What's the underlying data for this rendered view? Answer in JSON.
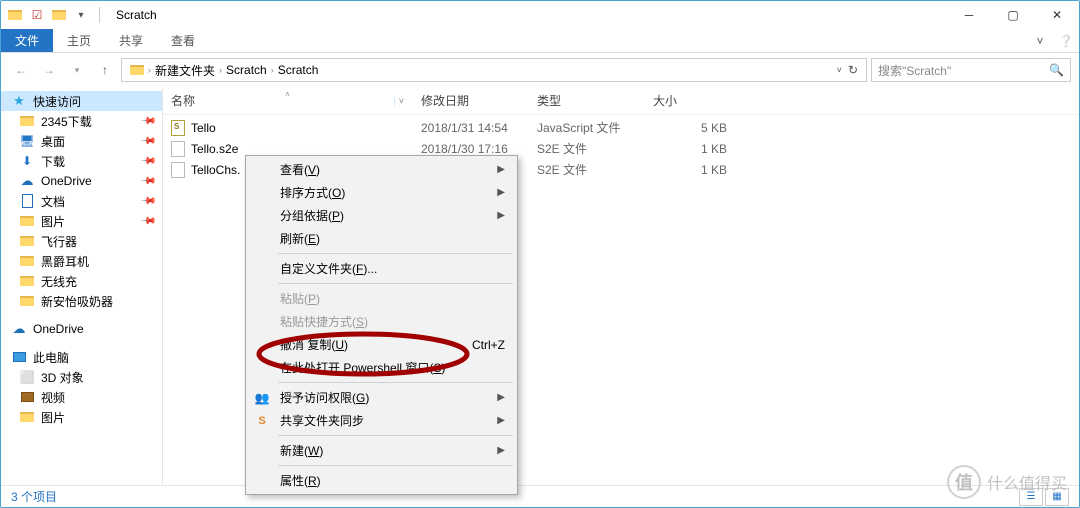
{
  "window": {
    "title": "Scratch"
  },
  "ribbon": {
    "file": "文件",
    "home": "主页",
    "share": "共享",
    "view": "查看"
  },
  "breadcrumb": {
    "root_icon": "folder",
    "segments": [
      "新建文件夹",
      "Scratch",
      "Scratch"
    ]
  },
  "search": {
    "placeholder": "搜索\"Scratch\""
  },
  "sidebar": {
    "quick": "快速访问",
    "items": [
      {
        "label": "2345下载",
        "icon": "folder",
        "pinned": true
      },
      {
        "label": "桌面",
        "icon": "desktop",
        "pinned": true
      },
      {
        "label": "下载",
        "icon": "download",
        "pinned": true
      },
      {
        "label": "OneDrive",
        "icon": "cloud",
        "pinned": true
      },
      {
        "label": "文档",
        "icon": "document",
        "pinned": true
      },
      {
        "label": "图片",
        "icon": "folder",
        "pinned": true
      },
      {
        "label": "飞行器",
        "icon": "folder",
        "pinned": false
      },
      {
        "label": "黑爵耳机",
        "icon": "folder",
        "pinned": false
      },
      {
        "label": "无线充",
        "icon": "folder",
        "pinned": false
      },
      {
        "label": "新安怡吸奶器",
        "icon": "folder",
        "pinned": false
      }
    ],
    "onedrive": "OneDrive",
    "thispc": "此电脑",
    "pc_items": [
      {
        "label": "3D 对象",
        "icon": "cube"
      },
      {
        "label": "视频",
        "icon": "video"
      },
      {
        "label": "图片",
        "icon": "folder"
      }
    ]
  },
  "columns": {
    "name": "名称",
    "date": "修改日期",
    "type": "类型",
    "size": "大小"
  },
  "files": [
    {
      "name": "Tello",
      "date": "2018/1/31 14:54",
      "type": "JavaScript 文件",
      "size": "5 KB",
      "icon": "js"
    },
    {
      "name": "Tello.s2e",
      "date": "2018/1/30 17:16",
      "type": "S2E 文件",
      "size": "1 KB",
      "icon": "file"
    },
    {
      "name": "TelloChs.",
      "date": "",
      "type": "S2E 文件",
      "size": "1 KB",
      "icon": "file"
    }
  ],
  "status": {
    "count": "3 个项目"
  },
  "context_menu": {
    "view": {
      "label": "查看(",
      "key": "V",
      "tail": ")"
    },
    "sort": {
      "label": "排序方式(",
      "key": "O",
      "tail": ")"
    },
    "group": {
      "label": "分组依据(",
      "key": "P",
      "tail": ")"
    },
    "refresh": {
      "label": "刷新(",
      "key": "E",
      "tail": ")"
    },
    "customize": {
      "label": "自定义文件夹(",
      "key": "F",
      "tail": ")..."
    },
    "paste": {
      "label": "粘贴(",
      "key": "P",
      "tail": ")"
    },
    "paste_shortcut": {
      "label": "粘贴快捷方式(",
      "key": "S",
      "tail": ")"
    },
    "undo": {
      "label": "撤消 复制(",
      "key": "U",
      "tail": ")",
      "shortcut": "Ctrl+Z"
    },
    "powershell": {
      "label": "在此处打开 Powershell 窗口(",
      "key": "S",
      "tail": ")"
    },
    "grant": {
      "label": "授予访问权限(",
      "key": "G",
      "tail": ")"
    },
    "sync": {
      "label": "共享文件夹同步"
    },
    "new": {
      "label": "新建(",
      "key": "W",
      "tail": ")"
    },
    "properties": {
      "label": "属性(",
      "key": "R",
      "tail": ")"
    }
  },
  "watermark": "什么值得买"
}
